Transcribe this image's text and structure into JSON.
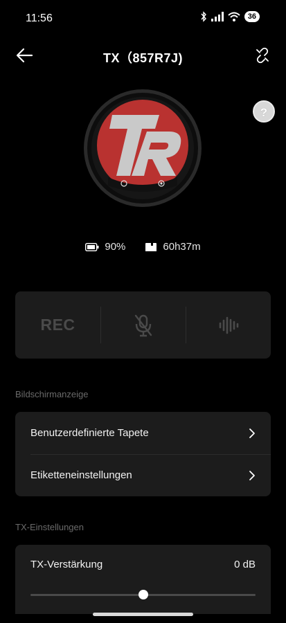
{
  "status_bar": {
    "time": "11:56",
    "battery": "36",
    "icons": [
      "bluetooth-icon",
      "signal-icon",
      "wifi-icon",
      "battery-icon"
    ]
  },
  "header": {
    "title": "TX（857R7J)",
    "back_icon": "arrow-left-icon",
    "action_icon": "unlink-icon"
  },
  "help": {
    "label": "?"
  },
  "device": {
    "logo": "TR",
    "colors": {
      "logo_red": "#c0312f",
      "logo_gray": "#c9c9c9",
      "ring": "#1a1a1a"
    }
  },
  "stats": {
    "battery": "90%",
    "storage": "60h37m"
  },
  "controls": {
    "rec_label": "REC",
    "mute_icon": "mic-muted-icon",
    "noise_icon": "waveform-icon"
  },
  "display_section": {
    "title": "Bildschirmanzeige",
    "items": [
      {
        "label": "Benutzerdefinierte Tapete"
      },
      {
        "label": "Etiketteneinstellungen"
      }
    ]
  },
  "tx_section": {
    "title": "TX-Einstellungen",
    "gain": {
      "label": "TX-Verstärkung",
      "value": "0 dB",
      "slider_fraction": 0.5
    }
  },
  "colors": {
    "background": "#000000",
    "card": "#1c1c1c",
    "muted_text": "#6a6a6a"
  }
}
